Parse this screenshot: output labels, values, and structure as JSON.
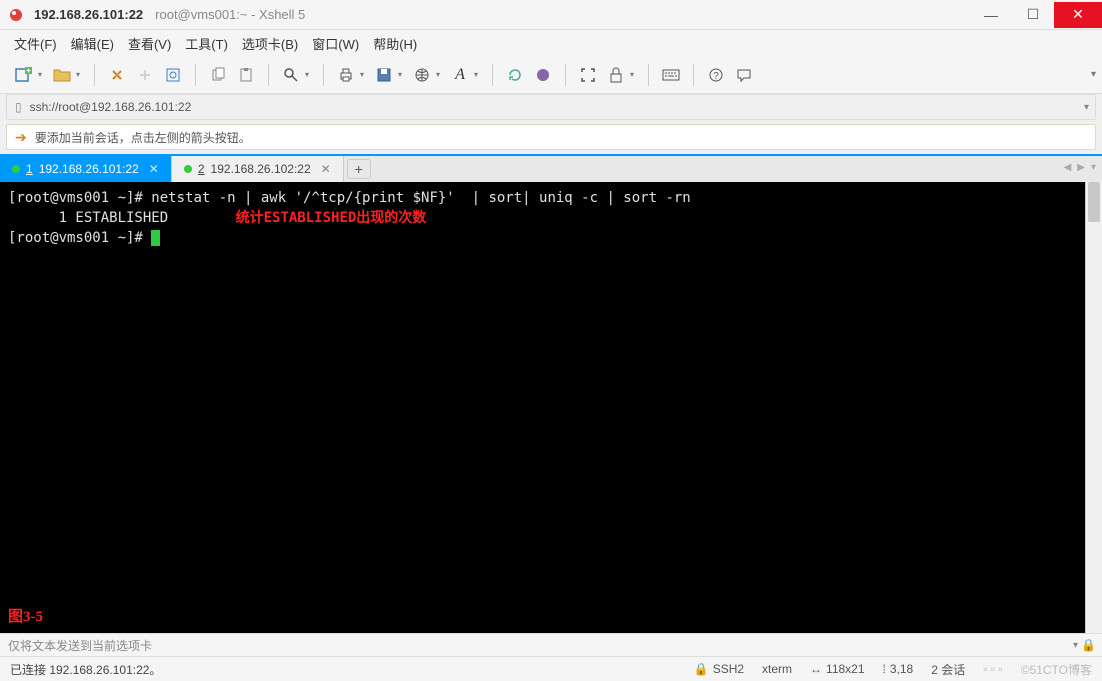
{
  "titlebar": {
    "active": "192.168.26.101:22",
    "rest": "root@vms001:~ - Xshell 5"
  },
  "menu": {
    "file": "文件(F)",
    "edit": "编辑(E)",
    "view": "查看(V)",
    "tools": "工具(T)",
    "tab": "选项卡(B)",
    "window": "窗口(W)",
    "help": "帮助(H)"
  },
  "addressbar": {
    "url": "ssh://root@192.168.26.101:22"
  },
  "infobar": {
    "text": "要添加当前会话，点击左侧的箭头按钮。"
  },
  "tabs": [
    {
      "num": "1",
      "label": "192.168.26.101:22",
      "active": true
    },
    {
      "num": "2",
      "label": "192.168.26.102:22",
      "active": false
    }
  ],
  "terminal": {
    "line1_prompt": "[root@vms001 ~]# ",
    "line1_cmd": "netstat -n | awk '/^tcp/{print $NF}'  | sort| uniq -c | sort -rn",
    "line2": "      1 ESTABLISHED",
    "annotation": "统计ESTABLISHED出现的次数",
    "line3_prompt": "[root@vms001 ~]# ",
    "fig_label": "图3-5"
  },
  "inputbar": {
    "placeholder": "仅将文本发送到当前选项卡"
  },
  "statusbar": {
    "left": "已连接 192.168.26.101:22。",
    "ssh": "SSH2",
    "term": "xterm",
    "size": "118x21",
    "pos": "3,18",
    "sessions": "2 会话",
    "watermark": "©51CTO博客"
  }
}
